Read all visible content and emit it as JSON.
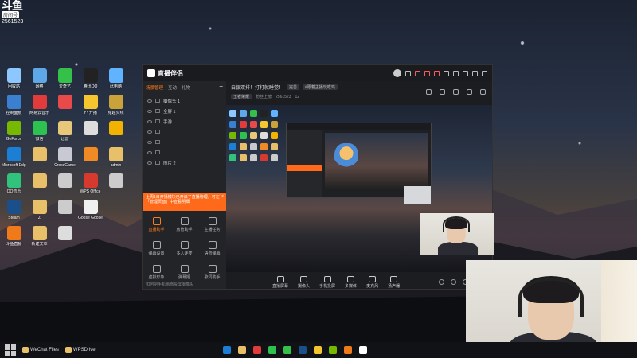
{
  "watermark": {
    "logo": "斗鱼",
    "sub": "房间号",
    "room_id": "2561523"
  },
  "desktop_icons": [
    {
      "label": "回收站",
      "color": "#8cc7ff"
    },
    {
      "label": "网络",
      "color": "#5fa8e8"
    },
    {
      "label": "爱奇艺",
      "color": "#35c04a"
    },
    {
      "label": "腾讯QQ",
      "color": "#222222"
    },
    {
      "label": "此电脑",
      "color": "#5fb3ff"
    },
    {
      "label": "控制面板",
      "color": "#3b7fd0"
    },
    {
      "label": "网易云音乐",
      "color": "#e23b3b"
    },
    {
      "label": "",
      "color": "#e84a4a"
    },
    {
      "label": "YY开播",
      "color": "#f5c530"
    },
    {
      "label": "穿越火线",
      "color": "#c9a23a"
    },
    {
      "label": "GeForce",
      "color": "#76b900"
    },
    {
      "label": "微信",
      "color": "#2dc14f"
    },
    {
      "label": "迅雷",
      "color": "#e8c77a"
    },
    {
      "label": "",
      "color": "#dddddd"
    },
    {
      "label": "",
      "color": "#f2b300"
    },
    {
      "label": "Microsoft Edge",
      "color": "#1c7fd6"
    },
    {
      "label": "",
      "color": "#e8c06a"
    },
    {
      "label": "CrossGame",
      "color": "#c9c9d4"
    },
    {
      "label": "",
      "color": "#f08a24"
    },
    {
      "label": "admin",
      "color": "#e8c06a"
    },
    {
      "label": "QQ音乐",
      "color": "#31c27c"
    },
    {
      "label": "",
      "color": "#e8c06a"
    },
    {
      "label": "",
      "color": "#cccccc"
    },
    {
      "label": "WPS Office",
      "color": "#d63a2f"
    },
    {
      "label": "",
      "color": "#cccccc"
    },
    {
      "label": "Steam",
      "color": "#1b4f8a"
    },
    {
      "label": "Z",
      "color": "#e8c06a"
    },
    {
      "label": "",
      "color": "#cccccc"
    },
    {
      "label": "Goose Goose Duck",
      "color": "#f0f0f0"
    },
    {
      "label": "",
      "color": "transparent"
    },
    {
      "label": "斗鱼直播",
      "color": "#f07a1a"
    },
    {
      "label": "新建文本",
      "color": "#e8c06a"
    },
    {
      "label": "",
      "color": "#dddddd"
    }
  ],
  "app": {
    "name": "直播伴侣",
    "version": "",
    "sidebar_tabs": [
      "场景管理",
      "互动",
      "礼物"
    ],
    "scenes": [
      {
        "label": "摄像头 1",
        "dim": false
      },
      {
        "label": "全屏 1",
        "dim": false
      },
      {
        "label": "手游",
        "dim": false
      },
      {
        "label": "",
        "dim": true
      },
      {
        "label": "",
        "dim": true
      },
      {
        "label": "",
        "dim": true
      },
      {
        "label": "图片 2",
        "dim": false
      }
    ],
    "notice": "上周1日开播模块已开启了直播管理，可在「管理页面」中查看明细",
    "tools": [
      {
        "label": "直播助手",
        "active": true
      },
      {
        "label": "房管助手",
        "active": false
      },
      {
        "label": "主播任务",
        "active": false
      },
      {
        "label": "弹幕设置",
        "active": false
      },
      {
        "label": "多人连麦",
        "active": false
      },
      {
        "label": "语音弹幕",
        "active": false
      },
      {
        "label": "虚拟形象",
        "active": false
      },
      {
        "label": "弹幕姬",
        "active": false
      },
      {
        "label": "歌词助手",
        "active": false
      }
    ],
    "sidebar_footer": "如何把手机画面投屏摄像头",
    "room_title": "白银双排！打打就睡觉！",
    "room_tags": [
      "完善",
      "#跟着主播玩吃鸡"
    ],
    "room_meta": [
      "王者荣耀",
      "粉丝上榜",
      "2561523",
      "12"
    ],
    "controls": [
      "直播屏幕",
      "摄像头",
      "手机投屏",
      "多媒体",
      "麦克风",
      "扬声器"
    ]
  },
  "taskbar": {
    "apps": [
      {
        "label": "WeChat Files",
        "color": "#e8c06a"
      },
      {
        "label": "WPSDrive",
        "color": "#e8c06a"
      }
    ],
    "pinned_colors": [
      "#1c7fd6",
      "#e8c06a",
      "#e23b3b",
      "#2dc14f",
      "#35c04a",
      "#1b4f8a",
      "#f5c530",
      "#76b900",
      "#f07a1a",
      "#ffffff"
    ]
  }
}
